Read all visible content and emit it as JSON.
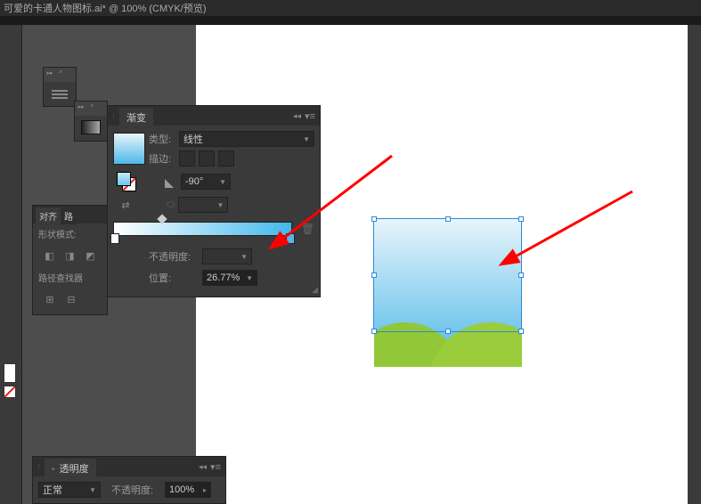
{
  "title": "可爱的卡通人物图标.ai* @ 100% (CMYK/预览)",
  "gradient_panel": {
    "title": "渐变",
    "type_label": "类型:",
    "type_value": "线性",
    "stroke_label": "描边:",
    "angle_value": "-90°",
    "opacity_label": "不透明度:",
    "position_label": "位置:",
    "position_value": "26.77%"
  },
  "pathfinder_panel": {
    "tabs": [
      "对齐",
      "路"
    ],
    "shape_mode_label": "形状模式:",
    "pathfinder_label": "路径查找器"
  },
  "transparency_panel": {
    "title": "透明度",
    "blend_mode": "正常",
    "opacity_label": "不透明度:",
    "opacity_value": "100%"
  }
}
